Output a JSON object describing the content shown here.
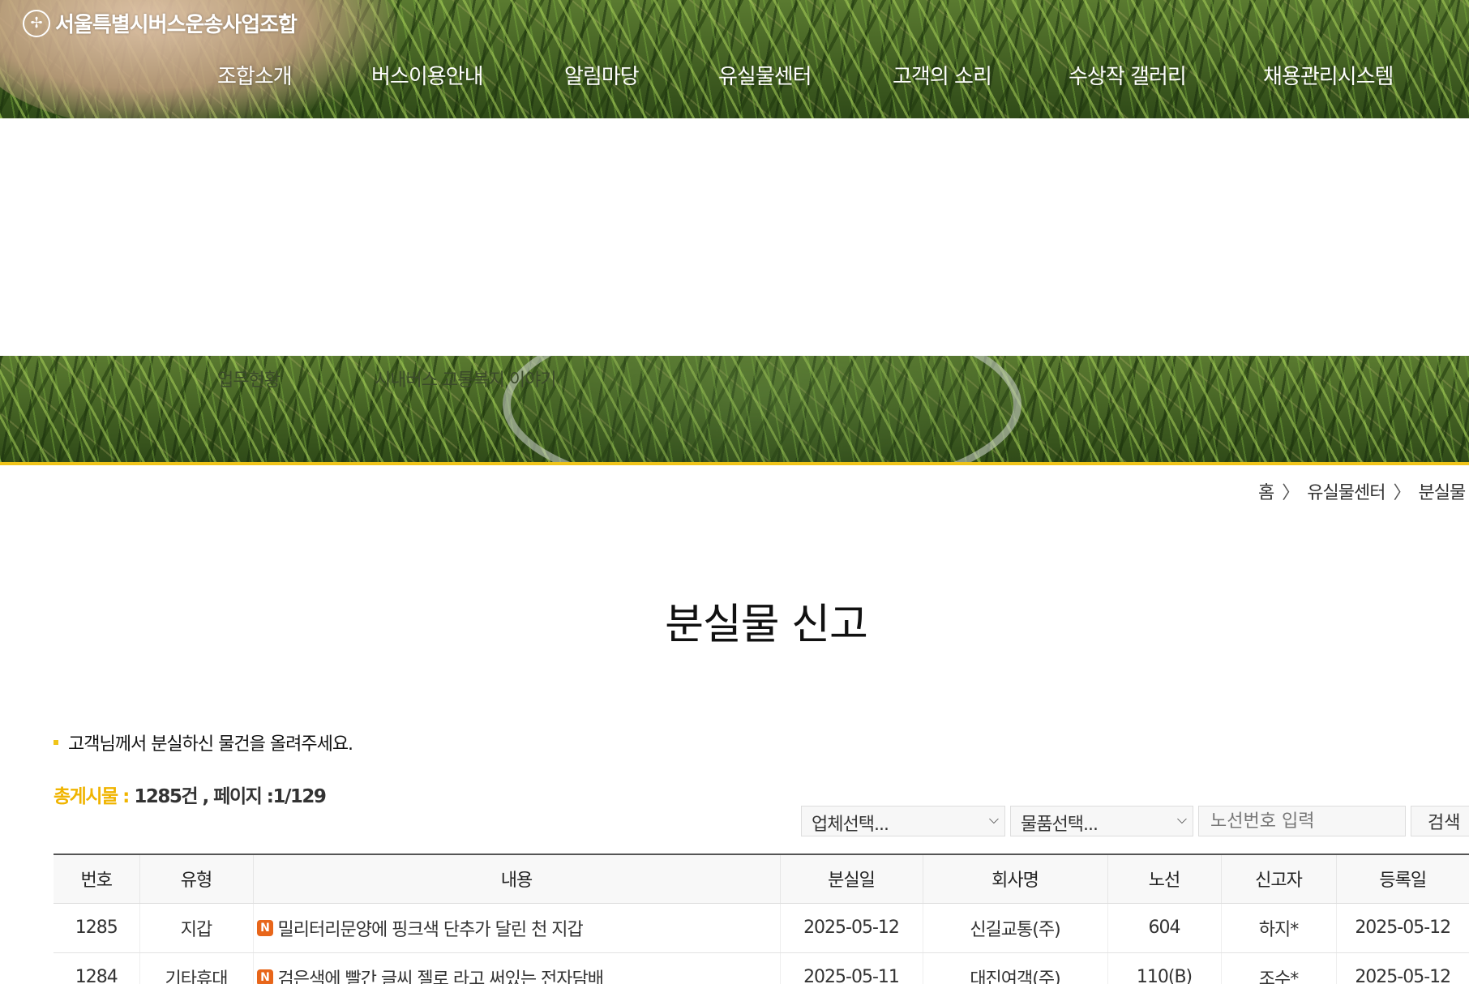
{
  "header": {
    "logo_symbol": "✢",
    "logo_text": "서울특별시버스운송사업조합",
    "nav": [
      "조합소개",
      "버스이용안내",
      "알림마당",
      "유실물센터",
      "고객의 소리",
      "수상작 갤러리",
      "채용관리시스템"
    ]
  },
  "subvisual": {
    "links": [
      "업무현황",
      "시내버스 교통복지 이야기"
    ]
  },
  "breadcrumb": {
    "home": "홈",
    "sep": "〉",
    "level1": "유실물센터",
    "level2": "분실물 신고"
  },
  "page": {
    "title": "분실물 신고",
    "notice": "고객님께서 분실하신 물건을 올려주세요.",
    "counter_label": "총게시물 :",
    "counter_value": " 1285건 , 페이지 :1/129"
  },
  "search": {
    "company_select": "업체선택...",
    "item_select": "물품선택...",
    "route_placeholder": "노선번호 입력",
    "button": "검색"
  },
  "colors": {
    "accent": "#f0c419",
    "new_badge": "#e8661a"
  },
  "table": {
    "headers": [
      "번호",
      "유형",
      "내용",
      "분실일",
      "회사명",
      "노선",
      "신고자",
      "등록일"
    ],
    "new_badge": "N",
    "rows": [
      {
        "no": "1285",
        "type": "지갑",
        "content": "밀리터리문양에 핑크색 단추가 달린 천 지갑",
        "lost_date": "2025-05-12",
        "company": "신길교통(주)",
        "route": "604",
        "reporter": "하지*",
        "reg_date": "2025-05-12"
      },
      {
        "no": "1284",
        "type": "기타휴대",
        "content": "검은색에 빨간 글씨 젤로 라고 써있는 전자담배",
        "lost_date": "2025-05-11",
        "company": "대진여객(주)",
        "route": "110(B)",
        "reporter": "조수*",
        "reg_date": "2025-05-12"
      }
    ]
  }
}
